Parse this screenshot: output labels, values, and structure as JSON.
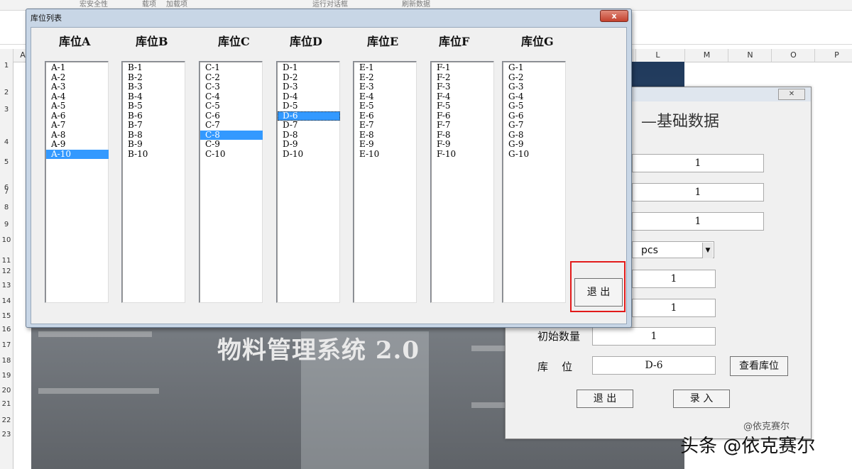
{
  "excel": {
    "ribbon": [
      "宏安全性",
      "载项",
      "加载项",
      "运行对话框",
      "刷新数据"
    ],
    "columns": [
      "A",
      "L",
      "M",
      "N",
      "O",
      "P"
    ],
    "rows": [
      "1",
      "2",
      "3",
      "4",
      "5",
      "6",
      "7",
      "8",
      "9",
      "10",
      "11",
      "12",
      "13",
      "14",
      "15",
      "16",
      "17",
      "18",
      "19",
      "20",
      "21",
      "22",
      "23"
    ]
  },
  "background": {
    "title": "物料管理系统 2.0",
    "watermark": "头条 @依克赛尔"
  },
  "form2": {
    "close": "✕",
    "title": "基础数据",
    "fields": [
      "1",
      "1",
      "1",
      "pcs",
      "1",
      "1",
      "1",
      "D-6"
    ],
    "label_qty": "初始数量",
    "label_loc": "库    位",
    "view_btn": "查看库位",
    "exit_btn": "退 出",
    "enter_btn": "录 入",
    "credit": "@依克赛尔"
  },
  "dialog": {
    "title": "库位列表",
    "close": "x",
    "exit_button": "退 出",
    "lists": [
      {
        "header": "库位A",
        "items": [
          "A-1",
          "A-2",
          "A-3",
          "A-4",
          "A-5",
          "A-6",
          "A-7",
          "A-8",
          "A-9",
          "A-10"
        ],
        "selected": 9
      },
      {
        "header": "库位B",
        "items": [
          "B-1",
          "B-2",
          "B-3",
          "B-4",
          "B-5",
          "B-6",
          "B-7",
          "B-8",
          "B-9",
          "B-10"
        ],
        "selected": -1
      },
      {
        "header": "库位C",
        "items": [
          "C-1",
          "C-2",
          "C-3",
          "C-4",
          "C-5",
          "C-6",
          "C-7",
          "C-8",
          "C-9",
          "C-10"
        ],
        "selected": 7
      },
      {
        "header": "库位D",
        "items": [
          "D-1",
          "D-2",
          "D-3",
          "D-4",
          "D-5",
          "D-6",
          "D-7",
          "D-8",
          "D-9",
          "D-10"
        ],
        "selected": 5
      },
      {
        "header": "库位E",
        "items": [
          "E-1",
          "E-2",
          "E-3",
          "E-4",
          "E-5",
          "E-6",
          "E-7",
          "E-8",
          "E-9",
          "E-10"
        ],
        "selected": -1
      },
      {
        "header": "库位F",
        "items": [
          "F-1",
          "F-2",
          "F-3",
          "F-4",
          "F-5",
          "F-6",
          "F-7",
          "F-8",
          "F-9",
          "F-10"
        ],
        "selected": -1
      },
      {
        "header": "库位G",
        "items": [
          "G-1",
          "G-2",
          "G-3",
          "G-4",
          "G-5",
          "G-6",
          "G-7",
          "G-8",
          "G-9",
          "G-10"
        ],
        "selected": -1
      }
    ],
    "colors": {
      "selection": "#3399ff",
      "highlight_box": "#e21a1a"
    }
  }
}
